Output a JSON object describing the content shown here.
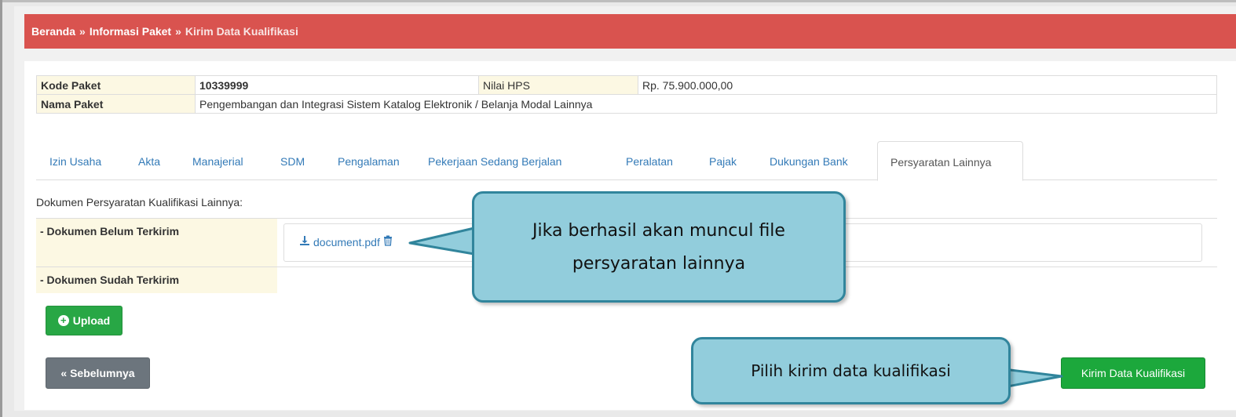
{
  "breadcrumb": {
    "items": [
      "Beranda",
      "Informasi Paket",
      "Kirim Data Kualifikasi"
    ],
    "separator": "»"
  },
  "package_info": {
    "kode_paket_label": "Kode Paket",
    "kode_paket_value": "10339999",
    "nilai_hps_label": "Nilai HPS",
    "nilai_hps_value": "Rp. 75.900.000,00",
    "nama_paket_label": "Nama Paket",
    "nama_paket_value": "Pengembangan dan Integrasi Sistem Katalog Elektronik / Belanja Modal Lainnya"
  },
  "tabs": [
    {
      "label": "Izin Usaha"
    },
    {
      "label": "Akta"
    },
    {
      "label": "Manajerial"
    },
    {
      "label": "SDM"
    },
    {
      "label": "Pengalaman"
    },
    {
      "label": "Pekerjaan Sedang Berjalan"
    },
    {
      "label": "Peralatan"
    },
    {
      "label": "Pajak"
    },
    {
      "label": "Dukungan Bank"
    },
    {
      "label": "Persyaratan Lainnya",
      "active": true
    }
  ],
  "documents": {
    "title": "Dokumen Persyaratan Kualifikasi Lainnya:",
    "not_sent_label": "- Dokumen Belum Terkirim",
    "sent_label": "- Dokumen Sudah Terkirim",
    "file_name": "document.pdf",
    "file_icon": "download-icon",
    "delete_icon": "trash-icon"
  },
  "buttons": {
    "upload": "Upload",
    "previous": "« Sebelumnya",
    "send": "Kirim Data Kualifikasi"
  },
  "callouts": {
    "upload_result_line1": "Jika berhasil akan muncul file",
    "upload_result_line2": "persyaratan lainnya",
    "send_hint": "Pilih kirim data kualifikasi"
  },
  "colors": {
    "breadcrumb_bg": "#d9534f",
    "label_bg": "#fcf8e3",
    "link": "#337ab7",
    "success": "#28a745",
    "secondary": "#6c757d",
    "callout_fill": "#92cddc",
    "callout_border": "#31859c"
  }
}
